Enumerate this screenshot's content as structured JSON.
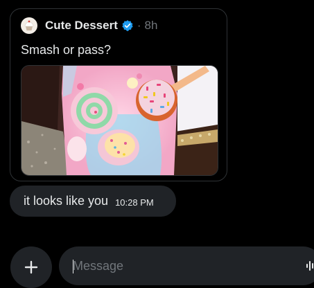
{
  "quoted_post": {
    "author": "Cute Dessert",
    "separator": "·",
    "time": "8h",
    "text": "Smash or pass?",
    "avatar_icon": "cupcake-icon",
    "verified_icon": "verified-badge-icon",
    "verified_color": "#1d9bf0"
  },
  "message": {
    "text": "it looks like you",
    "time": "10:28 PM"
  },
  "composer": {
    "placeholder": "Message",
    "add_icon": "plus-icon",
    "voice_icon": "voice-waveform-icon"
  },
  "colors": {
    "background": "#000000",
    "bubble": "#202327",
    "border": "#2f3336",
    "secondary_text": "#71767b"
  }
}
